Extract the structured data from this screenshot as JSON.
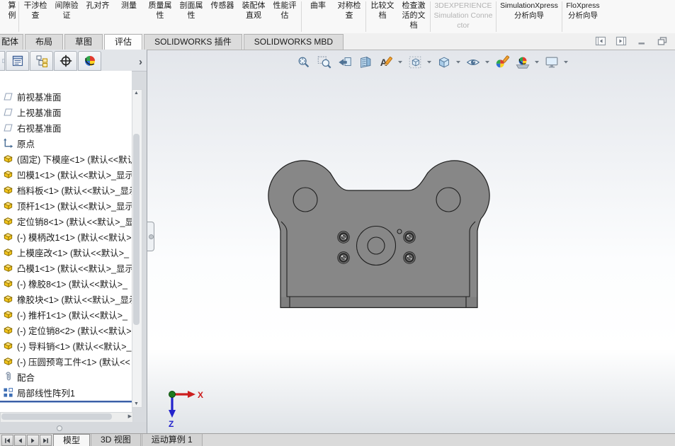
{
  "toolbar": {
    "partial_item": {
      "label": "算例",
      "dropdown": true
    },
    "groups": [
      {
        "items": [
          {
            "label": "干涉检查"
          },
          {
            "label": "间隙验证"
          },
          {
            "label": "孔对齐"
          },
          {
            "label": "测量"
          },
          {
            "label": "质量属性"
          },
          {
            "label": "剖面属性"
          },
          {
            "label": "传感器"
          },
          {
            "label": "装配体直观"
          },
          {
            "label": "性能评估"
          }
        ]
      },
      {
        "items": [
          {
            "label": "曲率"
          },
          {
            "label": "对称检查"
          }
        ]
      },
      {
        "items": [
          {
            "label": "比较文档"
          },
          {
            "label": "检查激活的文档",
            "dropdown": true
          }
        ]
      },
      {
        "items": [
          {
            "label": "3DEXPERIENCE Simulation Connector",
            "latin": true,
            "disabled": true
          }
        ]
      },
      {
        "items": [
          {
            "label": "SimulationXpress 分析向导",
            "latin": true
          }
        ]
      },
      {
        "items": [
          {
            "label": "FloXpress 分析向导",
            "latin": true,
            "narrow": true
          }
        ]
      }
    ]
  },
  "ribbon_tabs": [
    {
      "label": "配体",
      "partial": true
    },
    {
      "label": "布局"
    },
    {
      "label": "草图"
    },
    {
      "label": "评估",
      "active": true
    },
    {
      "label": "SOLIDWORKS 插件"
    },
    {
      "label": "SOLIDWORKS MBD"
    }
  ],
  "window_buttons": [
    {
      "name": "collapse-left-pane"
    },
    {
      "name": "collapse-right-pane"
    },
    {
      "name": "minimize-window"
    },
    {
      "name": "restore-window"
    }
  ],
  "panel_tabs": [
    {
      "icon": "featuremanager",
      "partial": true
    },
    {
      "icon": "propertymanager"
    },
    {
      "icon": "configurationmanager"
    },
    {
      "icon": "dimxpertmanager"
    },
    {
      "icon": "displaymanager"
    }
  ],
  "panel_expand": "›",
  "tree": {
    "items": [
      {
        "icon": "plane",
        "label": "前视基准面"
      },
      {
        "icon": "plane",
        "label": "上视基准面"
      },
      {
        "icon": "plane",
        "label": "右视基准面"
      },
      {
        "icon": "origin",
        "label": "原点"
      },
      {
        "icon": "part",
        "label": "(固定) 下模座<1> (默认<<默认"
      },
      {
        "icon": "part",
        "label": "凹模1<1> (默认<<默认>_显示"
      },
      {
        "icon": "part",
        "label": "档料板<1> (默认<<默认>_显示"
      },
      {
        "icon": "part",
        "label": "顶杆1<1> (默认<<默认>_显示"
      },
      {
        "icon": "part",
        "label": "定位销8<1> (默认<<默认>_显"
      },
      {
        "icon": "part",
        "label": "(-) 模柄改1<1> (默认<<默认>"
      },
      {
        "icon": "part",
        "label": "上模座改<1> (默认<<默认>_"
      },
      {
        "icon": "part",
        "label": "凸模1<1> (默认<<默认>_显示"
      },
      {
        "icon": "part",
        "label": "(-) 橡胶8<1> (默认<<默认>_"
      },
      {
        "icon": "part",
        "label": "橡胶块<1> (默认<<默认>_显示"
      },
      {
        "icon": "part",
        "label": "(-) 推杆1<1> (默认<<默认>_"
      },
      {
        "icon": "part",
        "label": "(-) 定位销8<2> (默认<<默认>"
      },
      {
        "icon": "part",
        "label": "(-) 导料销<1> (默认<<默认>_"
      },
      {
        "icon": "part",
        "label": "(-) 压圆预弯工件<1> (默认<<"
      },
      {
        "icon": "mate",
        "label": "配合"
      },
      {
        "icon": "pattern",
        "label": "局部线性阵列1"
      }
    ]
  },
  "headsup": [
    {
      "icon": "zoom-fit"
    },
    {
      "icon": "zoom-area"
    },
    {
      "icon": "previous-view"
    },
    {
      "icon": "section-view"
    },
    {
      "icon": "annotation-views",
      "dropdown": true
    },
    {
      "icon": "view-orientation",
      "dropdown": true
    },
    {
      "icon": "display-style",
      "dropdown": true
    },
    {
      "icon": "hide-show-items",
      "dropdown": true
    },
    {
      "icon": "edit-appearance"
    },
    {
      "icon": "apply-scene",
      "dropdown": true
    },
    {
      "icon": "view-settings",
      "dropdown": true
    }
  ],
  "bottom": {
    "nav": [
      "first",
      "previous",
      "next",
      "last"
    ],
    "tabs": [
      {
        "label": "模型",
        "active": true
      },
      {
        "label": "3D 视图"
      },
      {
        "label": "运动算例 1"
      }
    ]
  },
  "triad": {
    "x_label": "X",
    "z_label": "Z",
    "x_color": "#cc1f1f",
    "z_color": "#2323cc",
    "origin_color": "#1e7a1e"
  },
  "colors": {
    "model_gray": "#878787",
    "model_outline": "#1f1f1f",
    "rollback_blue": "#3b5fa6",
    "part_yellow": "#f3c51d",
    "viewport_top": "#e3e6eb"
  }
}
